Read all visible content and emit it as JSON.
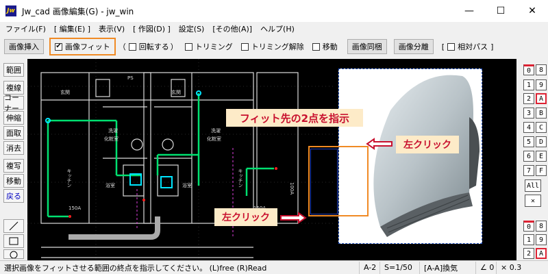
{
  "window": {
    "app_icon_text": "Jw",
    "title": "Jw_cad 画像編集(G) - jw_win",
    "minimize": "—",
    "maximize": "☐",
    "close": "✕"
  },
  "menu": [
    "ファイル(F)",
    "[ 編集(E) ]",
    "表示(V)",
    "[ 作図(D) ]",
    "設定(S)",
    "[その他(A)]",
    "ヘルプ(H)"
  ],
  "toolbar": {
    "insert_image": "画像挿入",
    "fit_image": {
      "label": "画像フィット",
      "checked": "✔"
    },
    "rotate_prefix": "（",
    "rotate": "回転する",
    "rotate_suffix": "）",
    "trim": "トリミング",
    "trim_release": "トリミング解除",
    "move": "移動",
    "image_bundle": "画像同梱",
    "image_separate": "画像分離",
    "relative_open": "[",
    "relative_path": "相対パス",
    "relative_close": "]"
  },
  "left_tools": [
    "範囲",
    "複線",
    "コーナー",
    "伸縮",
    "面取",
    "消去",
    "複写",
    "移動",
    "戻る"
  ],
  "right_tools": [
    [
      "0",
      "8"
    ],
    [
      "1",
      "9"
    ],
    [
      "2",
      "A"
    ],
    [
      "3",
      "B"
    ],
    [
      "4",
      "C"
    ],
    [
      "5",
      "D"
    ],
    [
      "6",
      "E"
    ],
    [
      "7",
      "F"
    ]
  ],
  "right_tools_extra": {
    "all": "All",
    "x": "✕"
  },
  "right_tools_lower": [
    [
      "0",
      "8"
    ],
    [
      "1",
      "9"
    ],
    [
      "2",
      "A"
    ]
  ],
  "callouts": {
    "instruction": "フィット先の2点を指示",
    "click1": "左クリック",
    "click2": "左クリック"
  },
  "drawing_labels": {
    "genkan1": "玄関",
    "genkan2": "玄関",
    "sentaku1": "洗濯",
    "sentaku2": "洗濯",
    "keshoshitsu1": "化粧室",
    "keshoshitsu2": "化粧室",
    "kitchen1": "キッチン",
    "kitchen2": "キッチン",
    "yoku1": "浴室",
    "yoku2": "浴室",
    "dim1": "150A",
    "dim2": "150A",
    "pipe": "100A",
    "ps": "PS"
  },
  "status": {
    "message": "選択画像をフィットさせる範囲の終点を指示してください。 (L)free (R)Read",
    "paper": "A-2",
    "scale": "S=1/50",
    "layer": "[A-A]換気",
    "angle": "∠ 0",
    "multiplier": "× 0.3"
  },
  "colors": {
    "accent_orange": "#f08a24",
    "callout_bg": "#fdebc8",
    "callout_text": "#c8102e",
    "drawing_green": "#00e070",
    "cyan": "#00e5ff"
  }
}
